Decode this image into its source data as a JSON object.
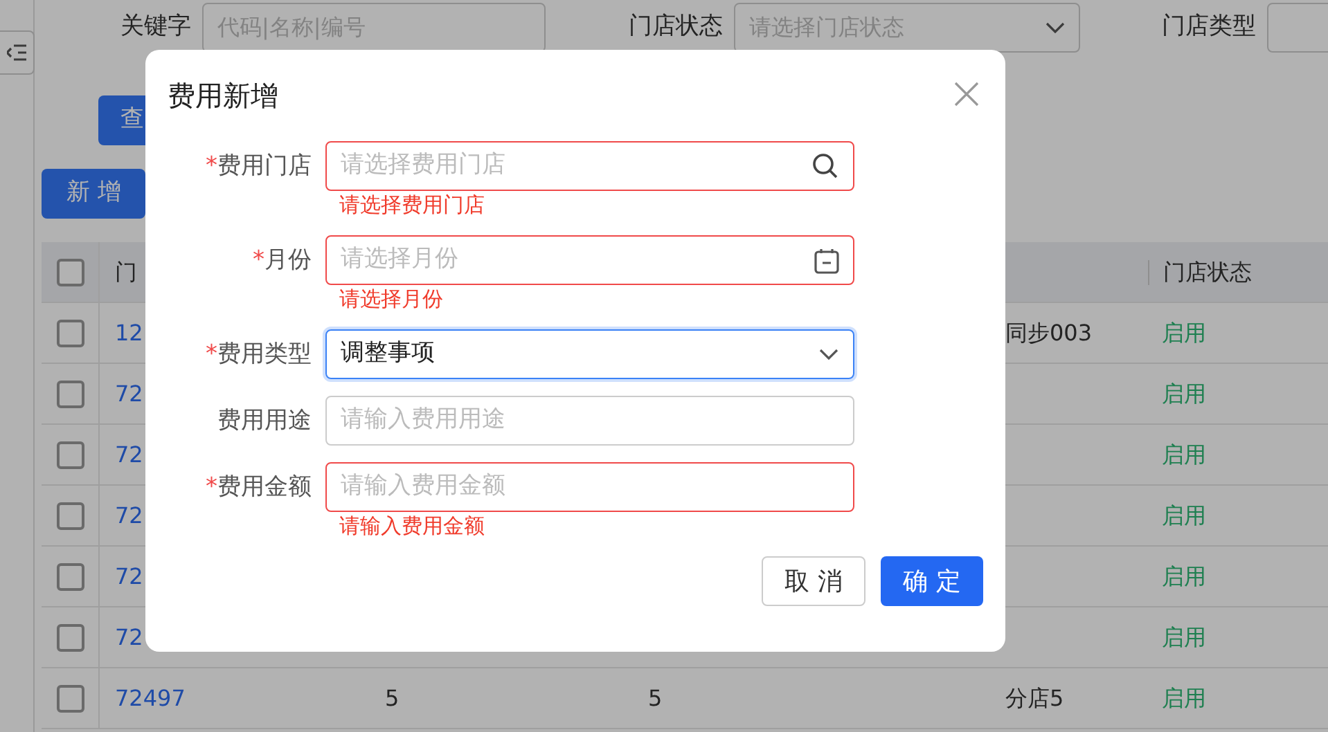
{
  "filters": [
    {
      "label": "关键字",
      "kind": "text",
      "placeholder": "代码|名称|编号"
    },
    {
      "label": "门店状态",
      "kind": "select",
      "placeholder": "请选择门店状态"
    },
    {
      "label": "门店类型",
      "kind": "select"
    }
  ],
  "query_button": "查",
  "add_button": "新 增",
  "table": {
    "select_all_checked": false,
    "columns": [
      {
        "label": "门"
      },
      {
        "label": "门店状态"
      }
    ],
    "rows": [
      {
        "checked": false,
        "code": "12",
        "column_3": "",
        "column_4": "",
        "name": "同步003",
        "status": "启用"
      },
      {
        "checked": false,
        "code": "72",
        "column_3": "",
        "column_4": "",
        "name": "",
        "status": "启用"
      },
      {
        "checked": false,
        "code": "72",
        "column_3": "",
        "column_4": "",
        "name": "",
        "status": "启用"
      },
      {
        "checked": false,
        "code": "72",
        "column_3": "",
        "column_4": "",
        "name": "",
        "status": "启用"
      },
      {
        "checked": false,
        "code": "72",
        "column_3": "",
        "column_4": "",
        "name": "",
        "status": "启用"
      },
      {
        "checked": false,
        "code": "72",
        "column_3": "",
        "column_4": "",
        "name": "",
        "status": "启用"
      },
      {
        "checked": false,
        "code": "72497",
        "column_3": "5",
        "column_4": "5",
        "name": "分店5",
        "status": "启用"
      }
    ]
  },
  "dialog": {
    "title": "费用新增",
    "fields": [
      {
        "required_mark": "*",
        "label": "费用门店",
        "kind": "search",
        "placeholder": "请选择费用门店",
        "error": "请选择费用门店",
        "focused": false
      },
      {
        "required_mark": "*",
        "label": "月份",
        "kind": "date",
        "placeholder": "请选择月份",
        "error": "请选择月份",
        "focused": false
      },
      {
        "required_mark": "*",
        "label": "费用类型",
        "kind": "select",
        "value": "调整事项",
        "focused": true
      },
      {
        "label": "费用用途",
        "kind": "text",
        "placeholder": "请输入费用用途",
        "focused": false
      },
      {
        "required_mark": "*",
        "label": "费用金额",
        "kind": "text",
        "placeholder": "请输入费用金额",
        "error": "请输入费用金额",
        "focused": false
      }
    ],
    "cancel_button": "取 消",
    "ok_button": "确 定"
  }
}
